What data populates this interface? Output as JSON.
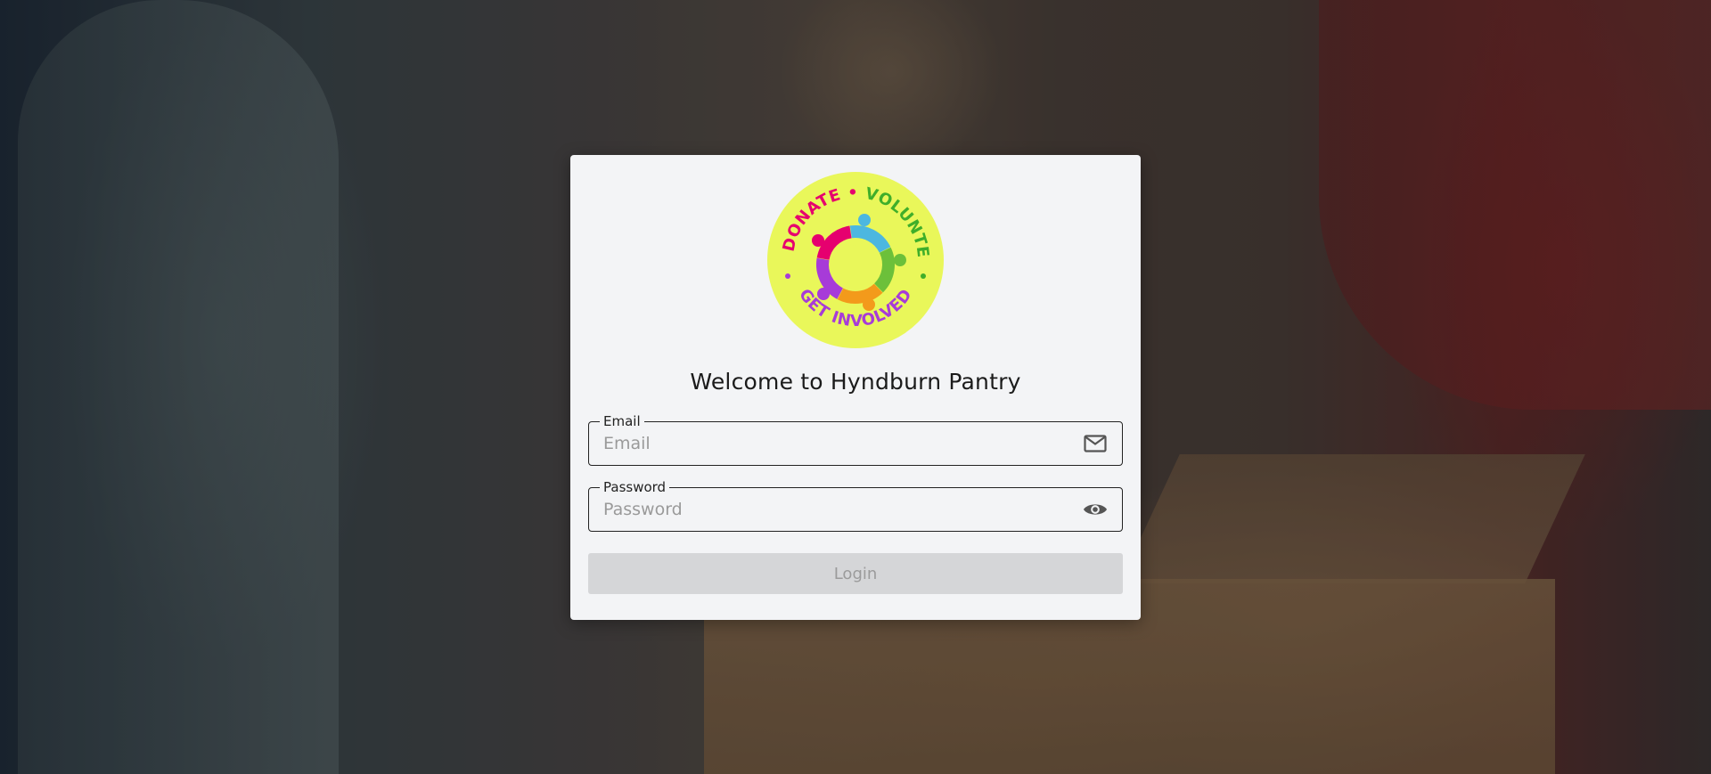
{
  "app": {
    "title": "Welcome to Hyndburn Pantry"
  },
  "logo": {
    "text_top_left": "DONATE",
    "text_top_right": "VOLUNTEER",
    "text_bottom": "GET INVOLVED",
    "background_color": "#e9f75a",
    "colors": [
      "#e6006f",
      "#4cb7e0",
      "#6cc03a",
      "#f39a1b",
      "#a73bd8"
    ]
  },
  "form": {
    "email": {
      "label": "Email",
      "placeholder": "Email",
      "value": "",
      "icon": "mail-icon"
    },
    "password": {
      "label": "Password",
      "placeholder": "Password",
      "value": "",
      "icon": "eye-icon"
    },
    "login_label": "Login",
    "login_disabled": true
  },
  "colors": {
    "card_background": "#f3f4f6",
    "button_disabled_background": "#d5d6d8",
    "button_disabled_text": "#9b9b9b",
    "border": "#222222"
  }
}
